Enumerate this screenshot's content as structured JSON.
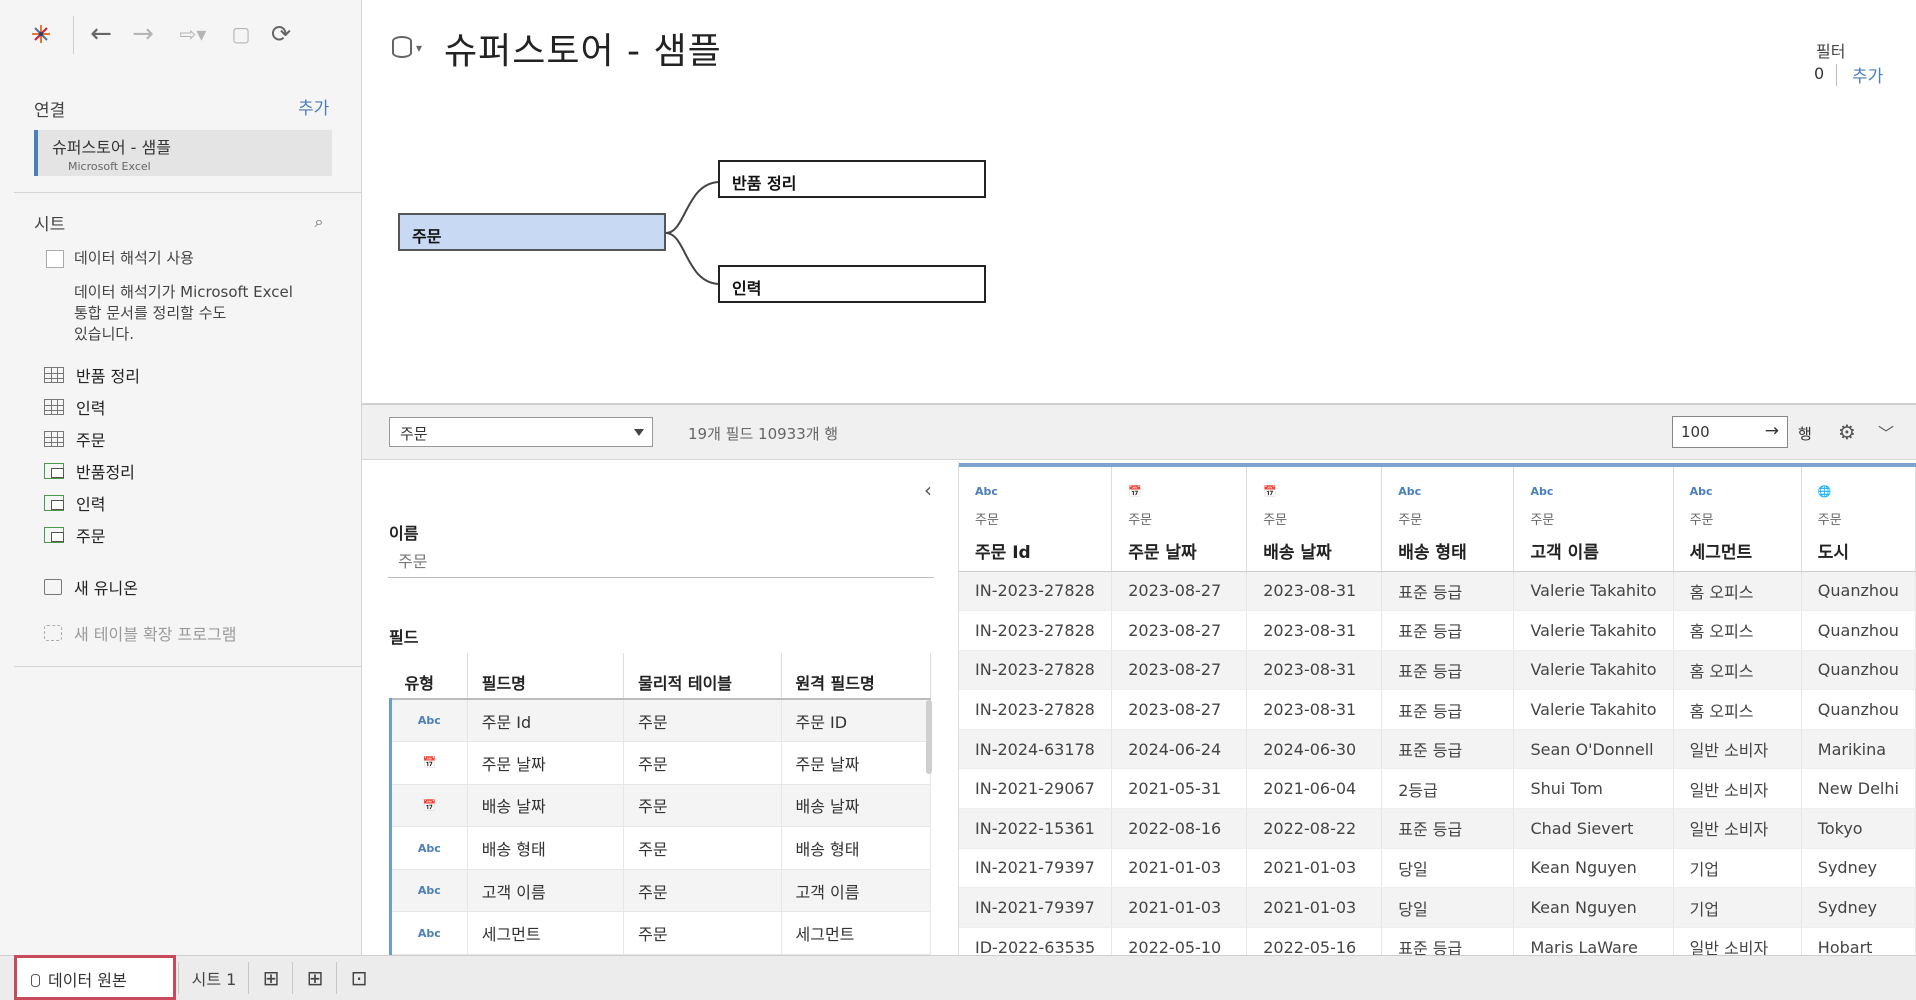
{
  "window": {
    "title": "슈퍼스토어 - 샘플"
  },
  "connections": {
    "header": "연결",
    "add": "추가",
    "item_name": "슈퍼스토어 - 샘플",
    "item_type": "Microsoft Excel"
  },
  "sheets_section": {
    "header": "시트",
    "interpreter_label": "데이터 해석기 사용",
    "interpreter_desc": [
      "데이터 해석기가 Microsoft Excel",
      "통합 문서를 정리할 수도",
      "있습니다."
    ],
    "items": [
      {
        "label": "반품 정리",
        "icon": "table-icon"
      },
      {
        "label": "인력",
        "icon": "table-icon"
      },
      {
        "label": "주문",
        "icon": "table-icon"
      },
      {
        "label": "반품정리",
        "icon": "named-range-icon"
      },
      {
        "label": "인력",
        "icon": "named-range-icon"
      },
      {
        "label": "주문",
        "icon": "named-range-icon"
      }
    ],
    "new_union": "새 유니온",
    "new_extension": "새 테이블 확장 프로그램"
  },
  "filters": {
    "label": "필터",
    "count": "0",
    "add": "추가"
  },
  "canvas": {
    "main_table": "주문",
    "joined": [
      "반품 정리",
      "인력"
    ]
  },
  "data_toolbar": {
    "table_select": "주문",
    "meta": "19개 필드 10933개 행",
    "row_count": "100",
    "rows_label": "행"
  },
  "metadata": {
    "name_label": "이름",
    "name_value": "주문",
    "fields_label": "필드",
    "columns": [
      "유형",
      "필드명",
      "물리적 테이블",
      "원격 필드명"
    ],
    "rows": [
      [
        "Abc",
        "주문 Id",
        "주문",
        "주문 ID"
      ],
      [
        "cal",
        "주문 날짜",
        "주문",
        "주문 날짜"
      ],
      [
        "cal",
        "배송 날짜",
        "주문",
        "배송 날짜"
      ],
      [
        "Abc",
        "배송 형태",
        "주문",
        "배송 형태"
      ],
      [
        "Abc",
        "고객 이름",
        "주문",
        "고객 이름"
      ],
      [
        "Abc",
        "세그먼트",
        "주문",
        "세그먼트"
      ]
    ]
  },
  "grid": {
    "columns": [
      {
        "type": "Abc",
        "table": "주문",
        "name": "주문 Id"
      },
      {
        "type": "cal",
        "table": "주문",
        "name": "주문 날짜"
      },
      {
        "type": "cal",
        "table": "주문",
        "name": "배송 날짜"
      },
      {
        "type": "Abc",
        "table": "주문",
        "name": "배송 형태"
      },
      {
        "type": "Abc",
        "table": "주문",
        "name": "고객 이름"
      },
      {
        "type": "Abc",
        "table": "주문",
        "name": "세그먼트"
      },
      {
        "type": "globe",
        "table": "주문",
        "name": "도시"
      }
    ],
    "rows": [
      [
        "IN-2023-27828",
        "2023-08-27",
        "2023-08-31",
        "표준 등급",
        "Valerie Takahito",
        "홈 오피스",
        "Quanzhou"
      ],
      [
        "IN-2023-27828",
        "2023-08-27",
        "2023-08-31",
        "표준 등급",
        "Valerie Takahito",
        "홈 오피스",
        "Quanzhou"
      ],
      [
        "IN-2023-27828",
        "2023-08-27",
        "2023-08-31",
        "표준 등급",
        "Valerie Takahito",
        "홈 오피스",
        "Quanzhou"
      ],
      [
        "IN-2023-27828",
        "2023-08-27",
        "2023-08-31",
        "표준 등급",
        "Valerie Takahito",
        "홈 오피스",
        "Quanzhou"
      ],
      [
        "IN-2024-63178",
        "2024-06-24",
        "2024-06-30",
        "표준 등급",
        "Sean O'Donnell",
        "일반 소비자",
        "Marikina"
      ],
      [
        "IN-2021-29067",
        "2021-05-31",
        "2021-06-04",
        "2등급",
        "Shui Tom",
        "일반 소비자",
        "New Delhi"
      ],
      [
        "IN-2022-15361",
        "2022-08-16",
        "2022-08-22",
        "표준 등급",
        "Chad Sievert",
        "일반 소비자",
        "Tokyo"
      ],
      [
        "IN-2021-79397",
        "2021-01-03",
        "2021-01-03",
        "당일",
        "Kean Nguyen",
        "기업",
        "Sydney"
      ],
      [
        "IN-2021-79397",
        "2021-01-03",
        "2021-01-03",
        "당일",
        "Kean Nguyen",
        "기업",
        "Sydney"
      ],
      [
        "ID-2022-63535",
        "2022-05-10",
        "2022-05-16",
        "표준 등급",
        "Maris LaWare",
        "일반 소비자",
        "Hobart"
      ]
    ]
  },
  "tabs": {
    "datasource": "데이터 원본",
    "sheet1": "시트 1"
  },
  "colors": {
    "accent": "#4a7fb8",
    "selected_node": "#c8daf3",
    "highlight": "#c94a5a"
  }
}
